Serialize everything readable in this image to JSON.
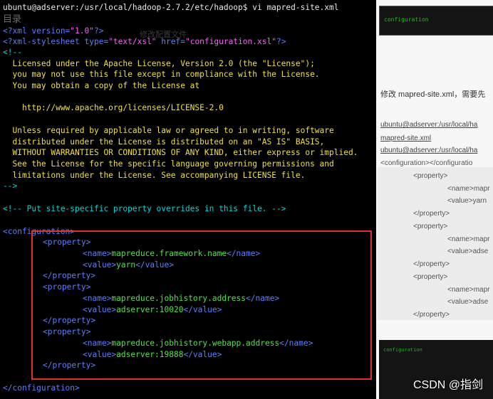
{
  "terminal": {
    "prompt": "ubuntu@adserver:/usr/local/hadoop-2.7.2/etc/hadoop$ vi mapred-site.xml",
    "xml_decl": {
      "open": "<?xml version=",
      "version": "\"1.0\"",
      "close": "?>"
    },
    "stylesheet": {
      "open": "<?xml-stylesheet type=",
      "type_val": "\"text/xsl\"",
      "href_attr": " href=",
      "href_val": "\"configuration.xsl\"",
      "close": "?>"
    },
    "comment_open": "<!--",
    "license_lines": [
      "  Licensed under the Apache License, Version 2.0 (the \"License\");",
      "  you may not use this file except in compliance with the License.",
      "  You may obtain a copy of the License at",
      "",
      "    http://www.apache.org/licenses/LICENSE-2.0",
      "",
      "  Unless required by applicable law or agreed to in writing, software",
      "  distributed under the License is distributed on an \"AS IS\" BASIS,",
      "  WITHOUT WARRANTIES OR CONDITIONS OF ANY KIND, either express or implied.",
      "  See the License for the specific language governing permissions and",
      "  limitations under the License. See accompanying LICENSE file."
    ],
    "comment_close": "-->",
    "site_comment": "<!-- Put site-specific property overrides in this file. -->",
    "config_open": "<configuration>",
    "config_close": "</configuration>",
    "property_open": "<property>",
    "property_close": "</property>",
    "name_open": "<name>",
    "name_close": "</name>",
    "value_open": "<value>",
    "value_close": "</value>",
    "properties": [
      {
        "name": "mapreduce.framework.name",
        "value": "yarn"
      },
      {
        "name": "mapreduce.jobhistory.address",
        "value": "adserver:10020"
      },
      {
        "name": "mapreduce.jobhistory.webapp.address",
        "value": "adserver:19888"
      }
    ],
    "overlay_title": "目录",
    "overlay_sub": "修改配置文件"
  },
  "background": {
    "top_code_line": "configuration",
    "text1": "修改 mapred-site.xml，需要先",
    "text2": "ubuntu@adserver:/usr/local/ha",
    "text3": "mapred-site.xml",
    "text4": "ubuntu@adserver:/usr/local/ha",
    "code_lines": [
      "<configuration></configuratio",
      "<property>",
      "<name>mapr",
      "<value>yarn",
      "</property>",
      "<property>",
      "<name>mapr",
      "<value>adse",
      "</property>",
      "<property>",
      "<name>mapr",
      "<value>adse",
      "</property>"
    ],
    "watermark": "CSDN @指剑"
  },
  "colors": {
    "terminal_bg": "#000000",
    "tag_blue": "#5e7cff",
    "string_magenta": "#ff5cff",
    "comment_cyan": "#00d8d8",
    "text_green": "#55e04a",
    "highlight_red": "#e03030"
  }
}
